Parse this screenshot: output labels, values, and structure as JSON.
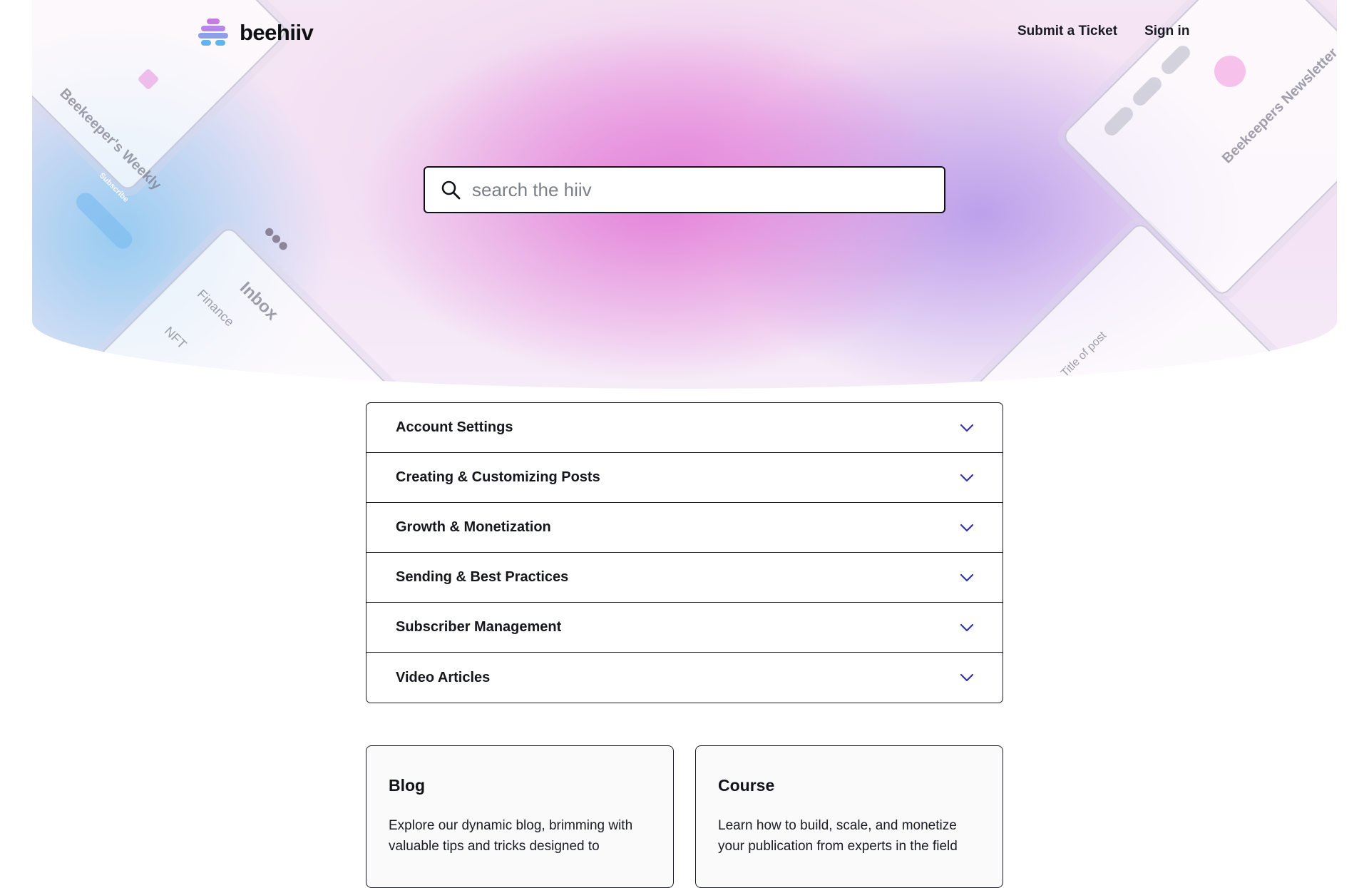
{
  "brand": {
    "name": "beehiiv",
    "logo_icon": "beehive-logo-icon",
    "colors": {
      "stripe1": "#c77be0",
      "stripe2": "#a98de8",
      "stripe3": "#7fa6ea",
      "stripe4": "#62b5ec"
    }
  },
  "nav": {
    "submit_ticket": "Submit a Ticket",
    "sign_in": "Sign in"
  },
  "search": {
    "placeholder": "search the hiiv",
    "icon": "search-icon"
  },
  "hero_decor": {
    "card1_title": "Beekeeper's Weekly",
    "card1_button": "Subscribe",
    "card2_title": "Inbox",
    "card2_item1": "Finance",
    "card2_item2": "NFT",
    "card3_title": "Beekeepers Newsletter",
    "card4_text": "Title of post"
  },
  "categories": [
    {
      "label": "Account Settings",
      "icon": "chevron-down-icon"
    },
    {
      "label": "Creating & Customizing Posts",
      "icon": "chevron-down-icon"
    },
    {
      "label": "Growth & Monetization",
      "icon": "chevron-down-icon"
    },
    {
      "label": "Sending & Best Practices",
      "icon": "chevron-down-icon"
    },
    {
      "label": "Subscriber Management",
      "icon": "chevron-down-icon"
    },
    {
      "label": "Video Articles",
      "icon": "chevron-down-icon"
    }
  ],
  "cards": [
    {
      "title": "Blog",
      "description": "Explore our dynamic blog, brimming with valuable tips and tricks designed to"
    },
    {
      "title": "Course",
      "description": "Learn how to build, scale, and monetize your publication from experts in the field"
    }
  ],
  "colors": {
    "chevron": "#2f35a8",
    "border": "#1a1c22"
  }
}
